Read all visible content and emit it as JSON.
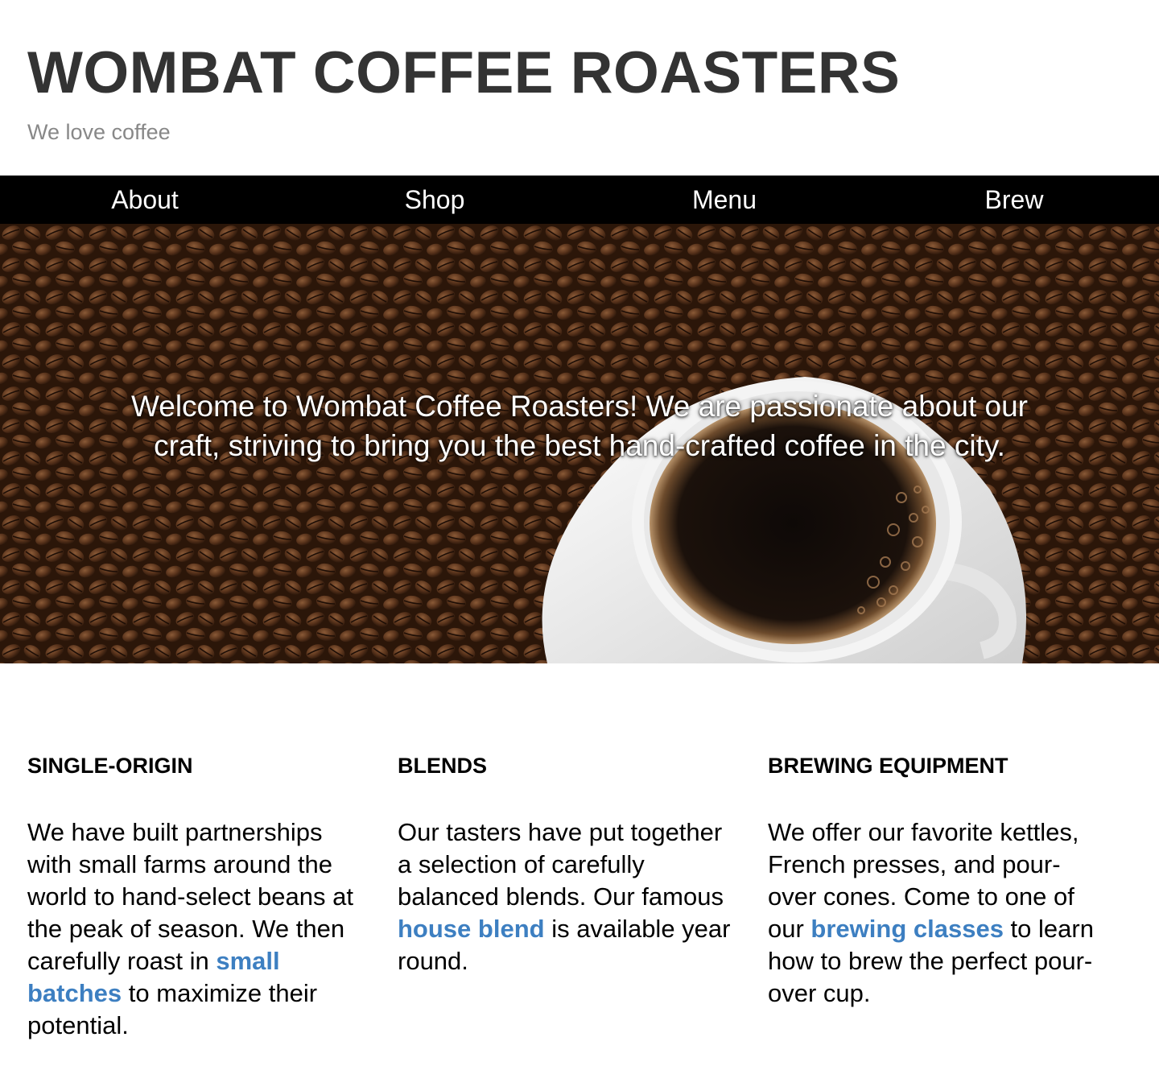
{
  "header": {
    "title": "WOMBAT COFFEE ROASTERS",
    "tagline": "We love coffee"
  },
  "nav": {
    "items": [
      "About",
      "Shop",
      "Menu",
      "Brew"
    ]
  },
  "hero": {
    "text": "Welcome to Wombat Coffee Roasters! We are passionate about our craft, striving to bring you the best hand-crafted coffee in the city."
  },
  "features": [
    {
      "heading": "SINGLE-ORIGIN",
      "text_before": "We have built partnerships with small farms around the world to hand-select beans at the peak of season. We then carefully roast in ",
      "link": "small batches",
      "text_after": " to maximize their potential."
    },
    {
      "heading": "BLENDS",
      "text_before": "Our tasters have put together a selection of carefully balanced blends. Our famous ",
      "link": "house blend",
      "text_after": " is available year round."
    },
    {
      "heading": "BREWING EQUIPMENT",
      "text_before": "We offer our favorite kettles, French presses, and pour-over cones. Come to one of our ",
      "link": "brewing classes",
      "text_after": " to learn how to brew the perfect pour-over cup."
    }
  ],
  "colors": {
    "title": "#333333",
    "tagline": "#888888",
    "nav_bg": "#000000",
    "link": "#3d7fc1"
  }
}
